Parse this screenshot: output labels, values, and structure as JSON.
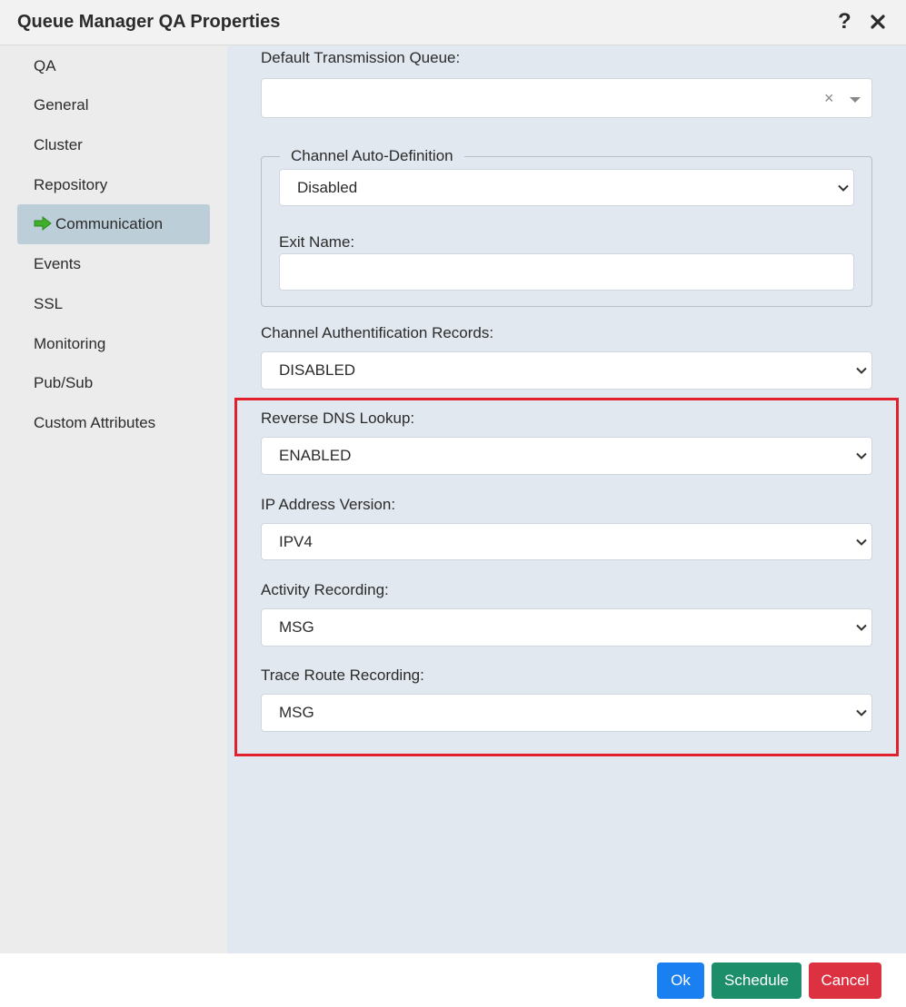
{
  "window": {
    "title": "Queue Manager QA Properties",
    "help_icon": "?"
  },
  "sidebar": {
    "items": [
      {
        "label": "QA"
      },
      {
        "label": "General"
      },
      {
        "label": "Cluster"
      },
      {
        "label": "Repository"
      },
      {
        "label": "Communication",
        "active": true
      },
      {
        "label": "Events"
      },
      {
        "label": "SSL"
      },
      {
        "label": "Monitoring"
      },
      {
        "label": "Pub/Sub"
      },
      {
        "label": "Custom Attributes"
      }
    ]
  },
  "form": {
    "default_transmission_queue": {
      "label": "Default Transmission Queue:",
      "value": "",
      "clear_glyph": "×"
    },
    "channel_auto_definition": {
      "legend": "Channel Auto-Definition",
      "value": "Disabled",
      "exit_name": {
        "label": "Exit Name:",
        "value": ""
      }
    },
    "channel_auth_records": {
      "label": "Channel Authentification Records:",
      "value": "DISABLED"
    },
    "reverse_dns_lookup": {
      "label": "Reverse DNS Lookup:",
      "value": "ENABLED"
    },
    "ip_address_version": {
      "label": "IP Address Version:",
      "value": "IPV4"
    },
    "activity_recording": {
      "label": "Activity Recording:",
      "value": "MSG"
    },
    "trace_route_recording": {
      "label": "Trace Route Recording:",
      "value": "MSG"
    }
  },
  "footer": {
    "ok_label": "Ok",
    "schedule_label": "Schedule",
    "cancel_label": "Cancel"
  },
  "colors": {
    "accent_ok": "#1a7ff0",
    "accent_schedule": "#1c8f6a",
    "accent_cancel": "#dc3141",
    "highlight": "#e0202a",
    "arrow_icon": "#3fae2a",
    "active_nav": "#bccfd9"
  }
}
